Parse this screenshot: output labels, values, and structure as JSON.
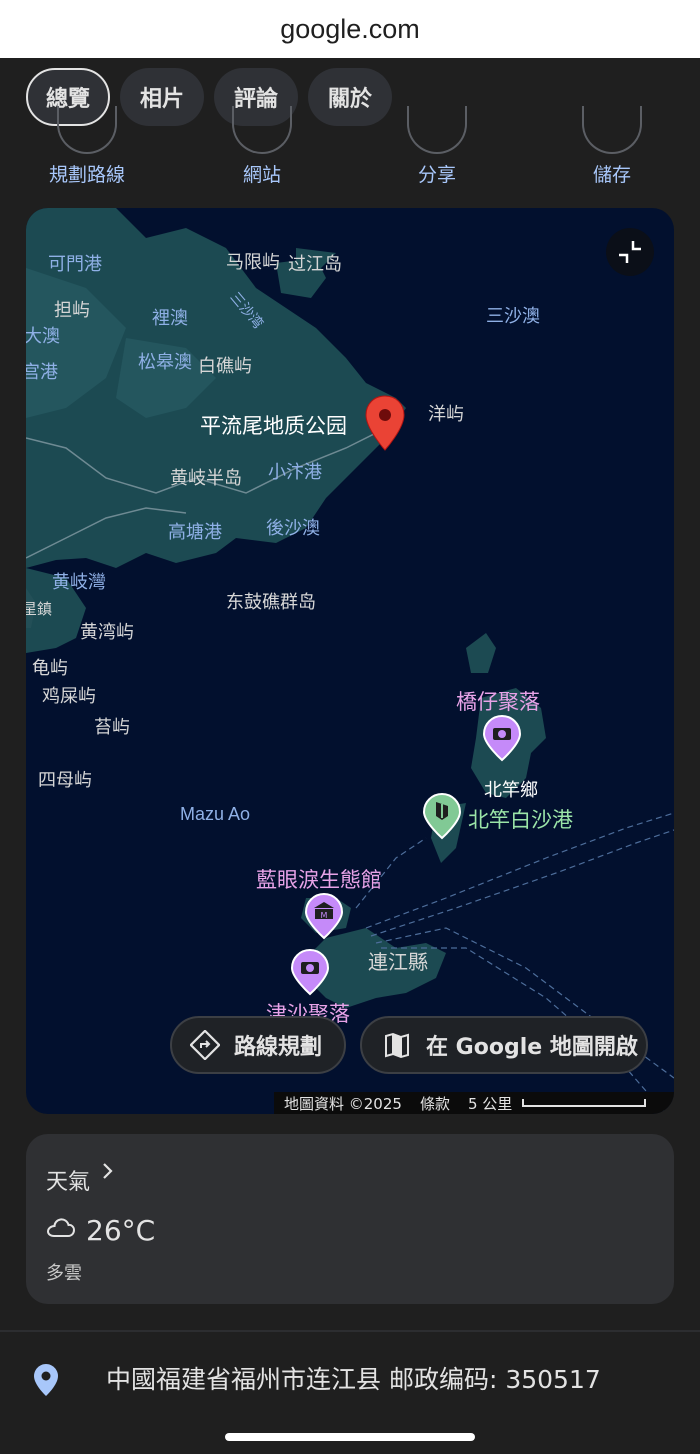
{
  "browser": {
    "url": "google.com"
  },
  "tabs": [
    {
      "label": "總覽",
      "active": true
    },
    {
      "label": "相片",
      "active": false
    },
    {
      "label": "評論",
      "active": false
    },
    {
      "label": "關於",
      "active": false
    }
  ],
  "actions": [
    {
      "label": "規劃路線"
    },
    {
      "label": "網站"
    },
    {
      "label": "分享"
    },
    {
      "label": "儲存"
    }
  ],
  "map": {
    "labels": {
      "kemengang": "可門港",
      "maxianyu": "马限屿",
      "guojiangdao": "过江岛",
      "danyu": "担屿",
      "liao": "裡澳",
      "sanshaao": "三沙澳",
      "daao": "大澳",
      "sanshawan": "三沙湾",
      "gonggang": "宫港",
      "songgaoao": "松皋澳",
      "baijiaoyu": "白礁屿",
      "yangyu": "洋屿",
      "huangqibandao": "黄岐半岛",
      "xiaojiegang": "小汴港",
      "gaotanggang": "高塘港",
      "houshaao": "後沙澳",
      "huangqiwan": "黄岐灣",
      "zhen": "星鎮",
      "donggujiaoqundao": "东鼓礁群岛",
      "huangwanyu": "黄湾屿",
      "guiyu": "龟屿",
      "jishiyu": "鸡屎屿",
      "taiyu": "苔屿",
      "simuyu": "四母屿",
      "mazuao": "Mazu Ao",
      "beiganxiang": "北竿鄉",
      "lianjiangxian": "連江縣"
    },
    "place": "平流尾地质公园",
    "pois": {
      "qiaozai": "橋仔聚落",
      "baishagang": "北竿白沙港",
      "lanyanlei": "藍眼淚生態館",
      "jinsha": "津沙聚落"
    },
    "buttons": {
      "directions": "路線規劃",
      "open_maps": "在 Google 地圖開啟"
    },
    "attribution": {
      "data": "地圖資料 ©2025",
      "terms": "條款",
      "scale": "5 公里"
    },
    "icons": {
      "collapse": "collapse-icon",
      "directions": "directions-icon",
      "map": "map-icon",
      "pin": "red-pin-icon"
    }
  },
  "weather": {
    "title": "天氣",
    "temperature": "26°C",
    "condition": "多雲"
  },
  "address": {
    "text": "中國福建省福州市连江县 邮政编码: 350517"
  },
  "colors": {
    "background": "#1f1f1f",
    "accent_blue": "#a8c7fa",
    "map_water": "#02102e",
    "map_land": "#1c4a52",
    "pin_red": "#ea4335",
    "poi_purple": "#c58af9",
    "poi_green": "#81c995"
  }
}
